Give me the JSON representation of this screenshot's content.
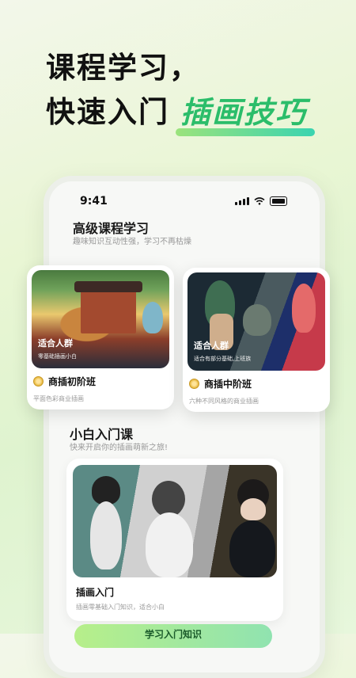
{
  "headline": {
    "line1": "课程学习，",
    "line2_prefix": "快速入门",
    "line2_accent": "插画技巧"
  },
  "status_bar": {
    "time": "9:41"
  },
  "advanced": {
    "title": "高级课程学习",
    "subtitle": "趣味知识互动性强，学习不再枯燥",
    "cards": [
      {
        "tag": "适合人群",
        "tag_sub": "零基础插画小白",
        "name": "商插初阶班",
        "desc": "平面色彩商业插画"
      },
      {
        "tag": "适合人群",
        "tag_sub": "适合有部分基础,上班族",
        "name": "商插中阶班",
        "desc": "六种不同风格的商业插画"
      }
    ]
  },
  "beginner": {
    "title": "小白入门课",
    "subtitle": "快来开启你的插画萌新之旅!",
    "course": {
      "name": "插画入门",
      "desc": "插画零基础入门知识，适合小白"
    },
    "cta_label": "学习入门知识"
  },
  "colors": {
    "accent_green": "#2bbd6a",
    "cta_gradient_start": "#b7ef8a",
    "cta_gradient_end": "#90e3b0"
  }
}
